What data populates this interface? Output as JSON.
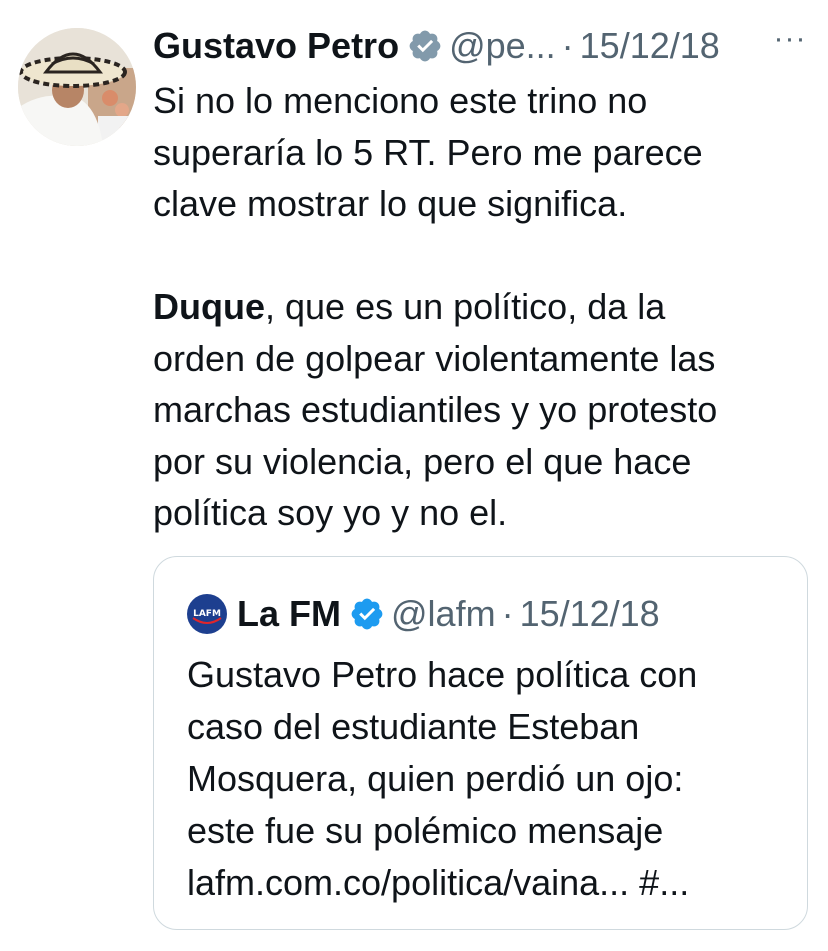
{
  "author": {
    "name": "Gustavo Petro",
    "handle": "@pe...",
    "separator": "·",
    "date": "15/12/18",
    "more": "···",
    "avatar_icon": "profile-photo-avatar",
    "verified_icon": "verified-badge-icon",
    "verified_color": "#829aab"
  },
  "tweet": {
    "lines_1": [
      "Si no lo menciono este trino no",
      "superaría lo 5 RT. Pero me parece",
      "clave mostrar lo que significa."
    ],
    "bold_word": "Duque",
    "line_2_rest": ", que es un político, da la",
    "lines_2": [
      "orden de golpear violentamente las",
      "marchas estudiantiles y yo protesto",
      "por su violencia, pero el que hace",
      "política soy yo y no el."
    ]
  },
  "quote": {
    "name": "La FM",
    "handle": "@lafm",
    "separator": "·",
    "date": "15/12/18",
    "logo_text": "LAFM",
    "logo_color": "#1d3f8f",
    "verified_color": "#1d9bf0",
    "lines": [
      "Gustavo Petro hace política con",
      "caso del estudiante Esteban",
      "Mosquera, quien perdió un ojo:",
      "este fue su polémico mensaje",
      "lafm.com.co/politica/vaina... #..."
    ]
  },
  "colors": {
    "text": "#0f1419",
    "secondary": "#536471",
    "border": "#cfd9de"
  }
}
